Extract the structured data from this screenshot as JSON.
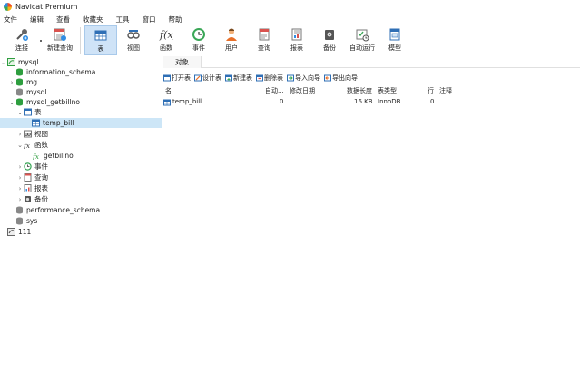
{
  "window": {
    "title": "Navicat Premium"
  },
  "menu": [
    "文件",
    "编辑",
    "查看",
    "收藏夹",
    "工具",
    "窗口",
    "帮助"
  ],
  "toolbar": {
    "connect": "连接",
    "new_query": "新建查询",
    "table": "表",
    "view": "视图",
    "function": "函数",
    "event": "事件",
    "user": "用户",
    "query": "查询",
    "report": "报表",
    "backup": "备份",
    "automation": "自动运行",
    "model": "模型"
  },
  "tree": {
    "connection": "mysql",
    "db_information_schema": "information_schema",
    "db_mg": "mg",
    "db_mysql": "mysql",
    "db_mysql_getbillno": "mysql_getbillno",
    "node_tables": "表",
    "table_temp_bill": "temp_bill",
    "node_views": "视图",
    "node_functions": "函数",
    "function_getbillno": "getbillno",
    "node_events": "事件",
    "node_queries": "查询",
    "node_reports": "报表",
    "node_backups": "备份",
    "db_performance_schema": "performance_schema",
    "db_sys": "sys",
    "connection_111": "111"
  },
  "tabs": {
    "objects": "对象"
  },
  "object_toolbar": {
    "open_table": "打开表",
    "design_table": "设计表",
    "new_table": "新建表",
    "delete_table": "删除表",
    "import_wizard": "导入向导",
    "export_wizard": "导出向导"
  },
  "table": {
    "headers": {
      "name": "名",
      "auto_inc": "自动...",
      "modified": "修改日期",
      "data_length": "数据长度",
      "table_type": "表类型",
      "rows": "行",
      "comment": "注释"
    },
    "rows": [
      {
        "name": "temp_bill",
        "auto_inc": "0",
        "modified": "",
        "data_length": "16 KB",
        "table_type": "InnoDB",
        "rows": "0",
        "comment": ""
      }
    ]
  },
  "colors": {
    "selection": "#cde6f7",
    "active_button": "#cfe3f7",
    "accent_green": "#2e9e3f"
  }
}
